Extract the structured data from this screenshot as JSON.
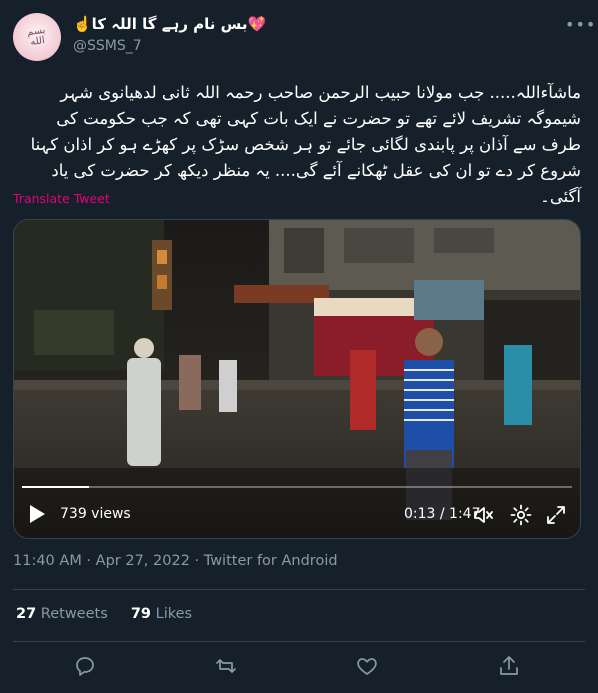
{
  "tweet": {
    "display_name": "💖بس نام رہے گا اللہ کا☝️",
    "handle": "@SSMS_7",
    "avatar_text": "بسم الله",
    "text": "ماشآءاللہ..... جب مولانا حبیب الرحمن صاحب رحمہ اللہ ثانی لدھیانوی شہر شیموگہ تشریف لائے تھے تو حضرت نے ایک بات کہی تھی کہ جب حکومت کی طرف سے آذان پر پابندی لگائی جائے تو ہر شخص سڑک پر کھڑے ہو کر اذان کہنا شروع کر دے تو ان کی عقل ٹھکانے آئے گی.... یہ منظر دیکھ کر حضرت کی یاد آگئی۔",
    "translate_label": "Translate Tweet",
    "timestamp": "11:40 AM · Apr 27, 2022 · Twitter for Android"
  },
  "video": {
    "views": "739 views",
    "time": "0:13 / 1:47",
    "progress": 0.121
  },
  "stats": {
    "retweets_count": "27",
    "retweets_label": "Retweets",
    "likes_count": "79",
    "likes_label": "Likes"
  },
  "colors": {
    "background": "#15202b",
    "muted": "#8b98a5",
    "translate": "#e6007a",
    "border": "#38444d"
  },
  "icons": {
    "more": "more-icon",
    "play": "play-icon",
    "volume": "volume-icon",
    "settings": "settings-icon",
    "fullscreen": "fullscreen-icon",
    "reply": "reply-icon",
    "retweet": "retweet-icon",
    "like": "like-icon",
    "share": "share-icon"
  }
}
